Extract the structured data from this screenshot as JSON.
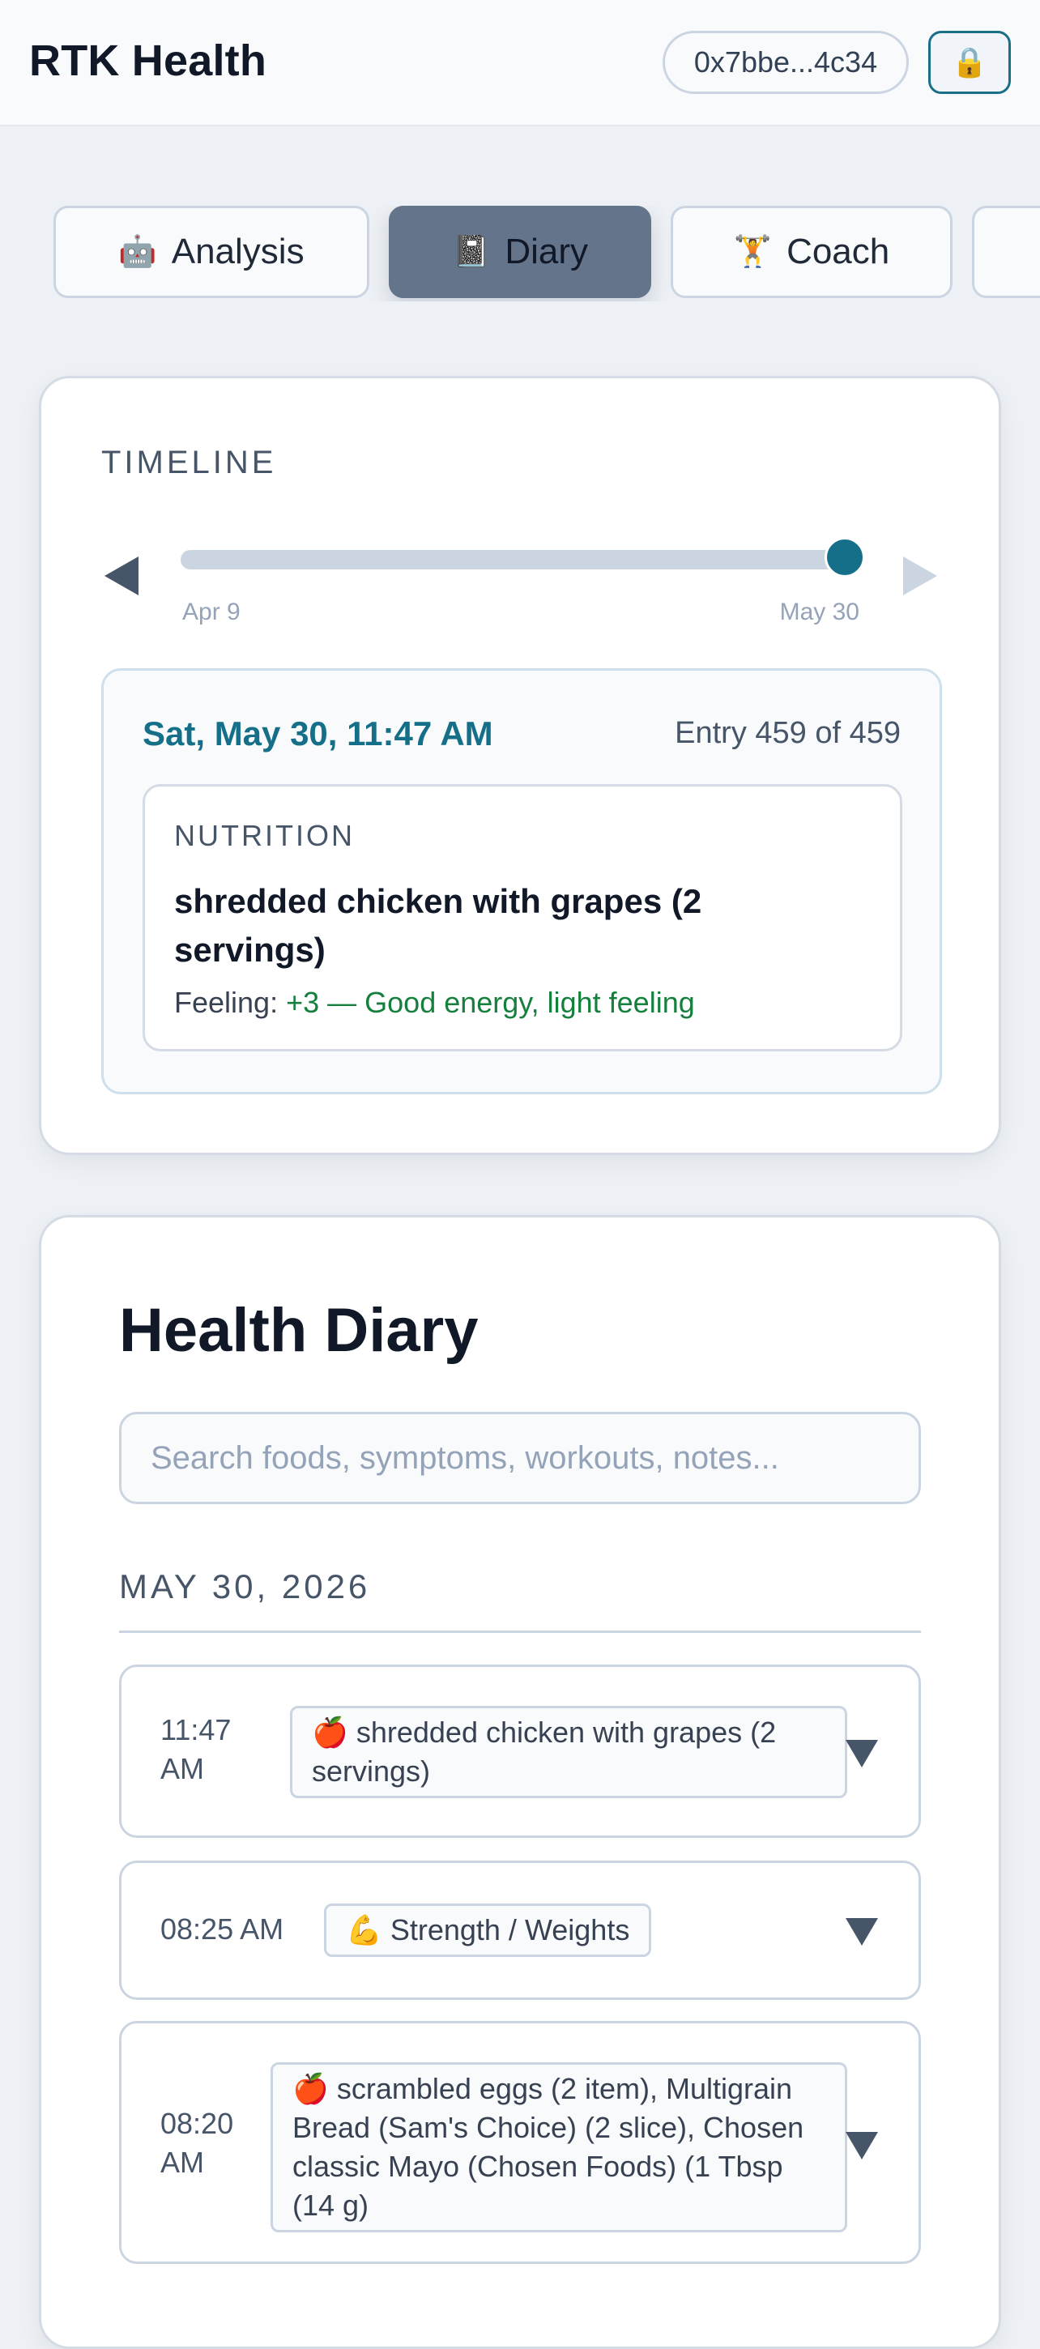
{
  "header": {
    "title": "RTK Health",
    "wallet": "0x7bbe...4c34",
    "lock_icon": "🔒"
  },
  "tabs": [
    {
      "icon": "🤖",
      "label": "Analysis",
      "active": false
    },
    {
      "icon": "📓",
      "label": "Diary",
      "active": true
    },
    {
      "icon": "🏋",
      "label": "Coach",
      "active": false
    }
  ],
  "timeline": {
    "label": "TIMELINE",
    "range_start": "Apr 9",
    "range_end": "May 30",
    "position_fraction": 1.0,
    "entry": {
      "datetime": "Sat, May 30, 11:47 AM",
      "counter": "Entry 459 of 459",
      "category": "NUTRITION",
      "title": "shredded chicken with grapes (2 servings)",
      "feeling_label": "Feeling:",
      "feeling_value": "+3 — Good energy, light feeling"
    }
  },
  "diary": {
    "title": "Health Diary",
    "search_placeholder": "Search foods, symptoms, workouts, notes...",
    "date_heading": "MAY 30, 2026",
    "rows": [
      {
        "time": "11:47 AM",
        "icon": "🍎",
        "text": "shredded chicken with grapes (2 servings)"
      },
      {
        "time": "08:25 AM",
        "icon": "💪",
        "text": "Strength / Weights"
      },
      {
        "time": "08:20 AM",
        "icon": "🍎",
        "text": "scrambled eggs (2 item), Multigrain Bread (Sam's Choice) (2 slice), Chosen classic Mayo (Chosen Foods) (1 Tbsp (14 g)"
      }
    ]
  },
  "colors": {
    "accent": "#166f88",
    "active_tab": "#64748b",
    "feeling_positive": "#15803d"
  }
}
